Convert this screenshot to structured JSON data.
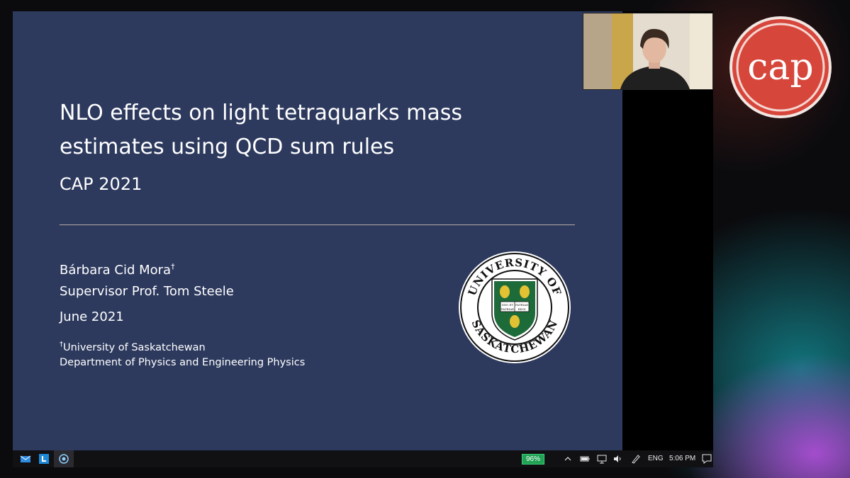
{
  "slide": {
    "title_line1": "NLO effects on light tetraquarks mass",
    "title_line2": "estimates using QCD sum rules",
    "subtitle": "CAP 2021",
    "author_name": "Bárbara Cid Mora",
    "author_mark": "†",
    "supervisor": "Supervisor Prof. Tom Steele",
    "date": "June 2021",
    "affiliation_mark": "†",
    "affiliation_line1": "University of Saskatchewan",
    "affiliation_line2": "Department of Physics and Engineering Physics",
    "seal_text_top": "UNIVERSITY OF",
    "seal_text_bottom": "SASKATCHEWAN",
    "seal_book_left": "DEO ET",
    "seal_book_right": "PATRIAE",
    "seal_book_left2": "PATRIAE",
    "seal_book_right2": "REGI"
  },
  "taskbar": {
    "battery": "96%",
    "language": "ENG",
    "clock": "5:06 PM",
    "icons": [
      "mail-icon",
      "app-l-icon",
      "circle-app-icon",
      "chevron-up-icon",
      "battery-icon",
      "network-icon",
      "volume-icon",
      "pen-icon",
      "notification-icon"
    ]
  },
  "logo": {
    "text": "cap",
    "color": "#d6463b"
  },
  "colors": {
    "slide_bg": "#2d3a5e",
    "rule": "#b8a9a4",
    "seal_green": "#1e6b3a",
    "seal_gold": "#e2c233"
  }
}
